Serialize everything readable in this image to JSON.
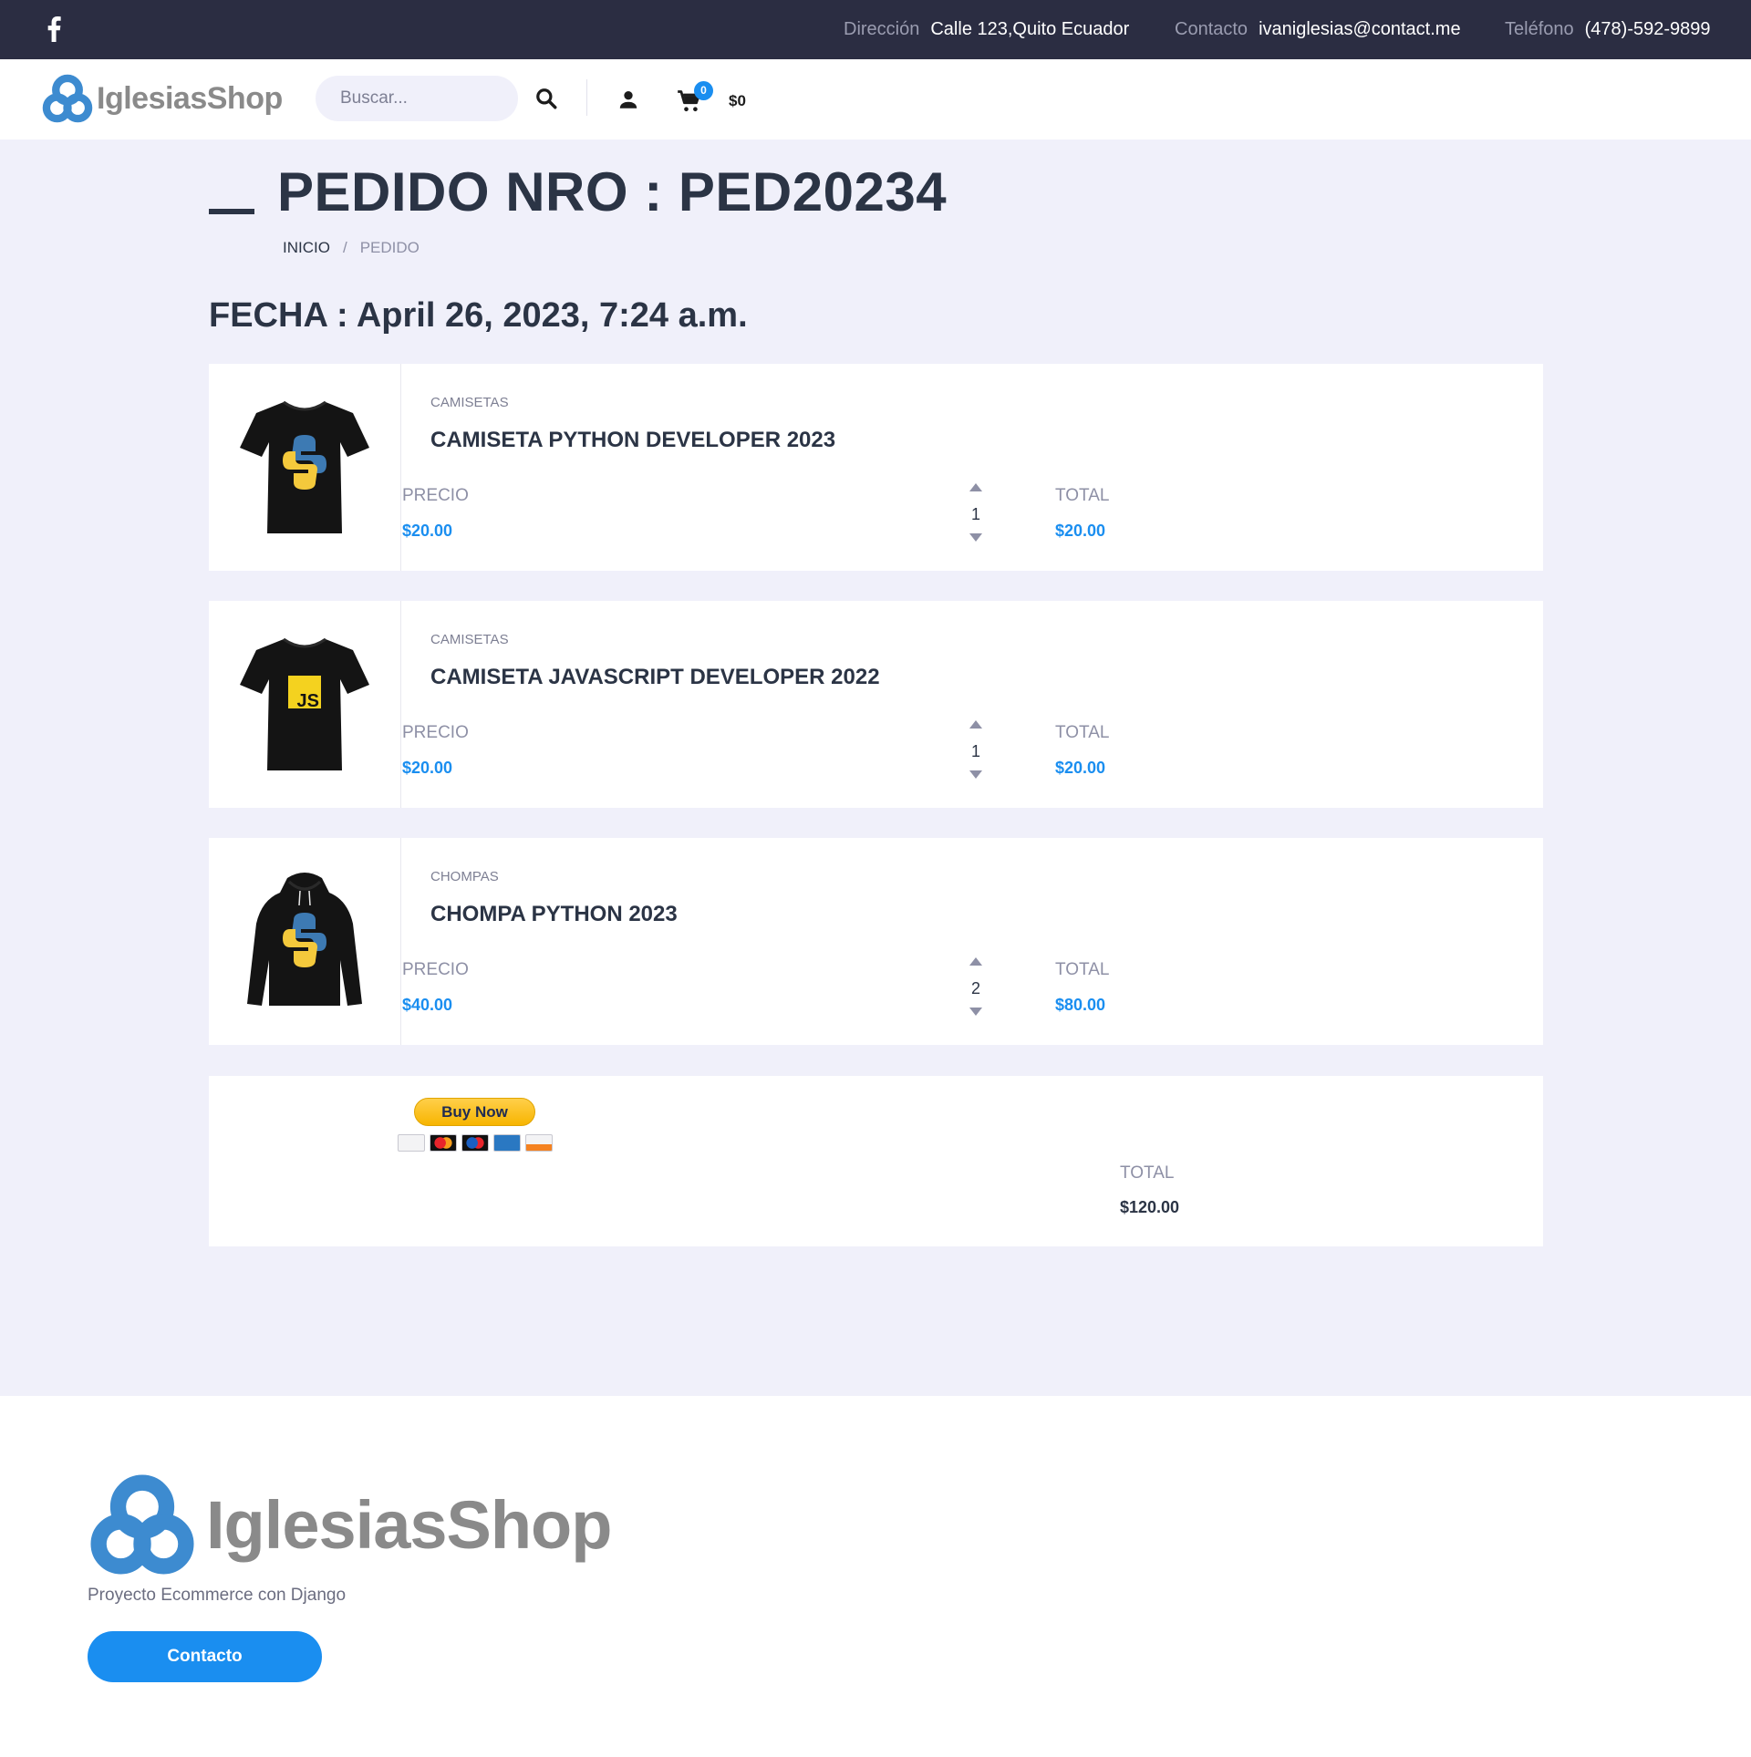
{
  "topbar": {
    "address_label": "Dirección",
    "address_value": "Calle 123,Quito Ecuador",
    "contact_label": "Contacto",
    "contact_value": "ivaniglesias@contact.me",
    "phone_label": "Teléfono",
    "phone_value": "(478)-592-9899"
  },
  "header": {
    "logo_text": "IglesiasShop",
    "search_placeholder": "Buscar...",
    "cart_count": "0",
    "cart_total": "$0"
  },
  "page": {
    "title": "PEDIDO NRO : PED20234",
    "breadcrumb": {
      "home": "INICIO",
      "separator": "/",
      "current": "PEDIDO"
    },
    "fecha": "FECHA : April 26, 2023, 7:24 a.m."
  },
  "labels": {
    "precio": "PRECIO",
    "total": "TOTAL"
  },
  "items": [
    {
      "category": "CAMISETAS",
      "name": "CAMISETA PYTHON DEVELOPER 2023",
      "price": "$20.00",
      "qty": "1",
      "total": "$20.00",
      "image_icon": "python-tshirt-icon"
    },
    {
      "category": "CAMISETAS",
      "name": "CAMISETA JAVASCRIPT DEVELOPER 2022",
      "price": "$20.00",
      "qty": "1",
      "total": "$20.00",
      "image_icon": "javascript-tshirt-icon",
      "js_label": "JS"
    },
    {
      "category": "CHOMPAS",
      "name": "CHOMPA PYTHON 2023",
      "price": "$40.00",
      "qty": "2",
      "total": "$80.00",
      "image_icon": "python-hoodie-icon"
    }
  ],
  "summary": {
    "buy_now_label": "Buy Now",
    "total_label": "TOTAL",
    "total_value": "$120.00"
  },
  "footer": {
    "logo_text": "IglesiasShop",
    "tagline": "Proyecto Ecommerce con Django",
    "contact_button": "Contacto"
  },
  "colors": {
    "topbar_bg": "#2b2d42",
    "page_bg": "#f0f0fa",
    "accent": "#1a8ef0",
    "text_dark": "#2b3445",
    "text_muted": "#8e90a6",
    "logo_blue": "#3d8bd0",
    "logo_gray": "#8a8a8a"
  }
}
